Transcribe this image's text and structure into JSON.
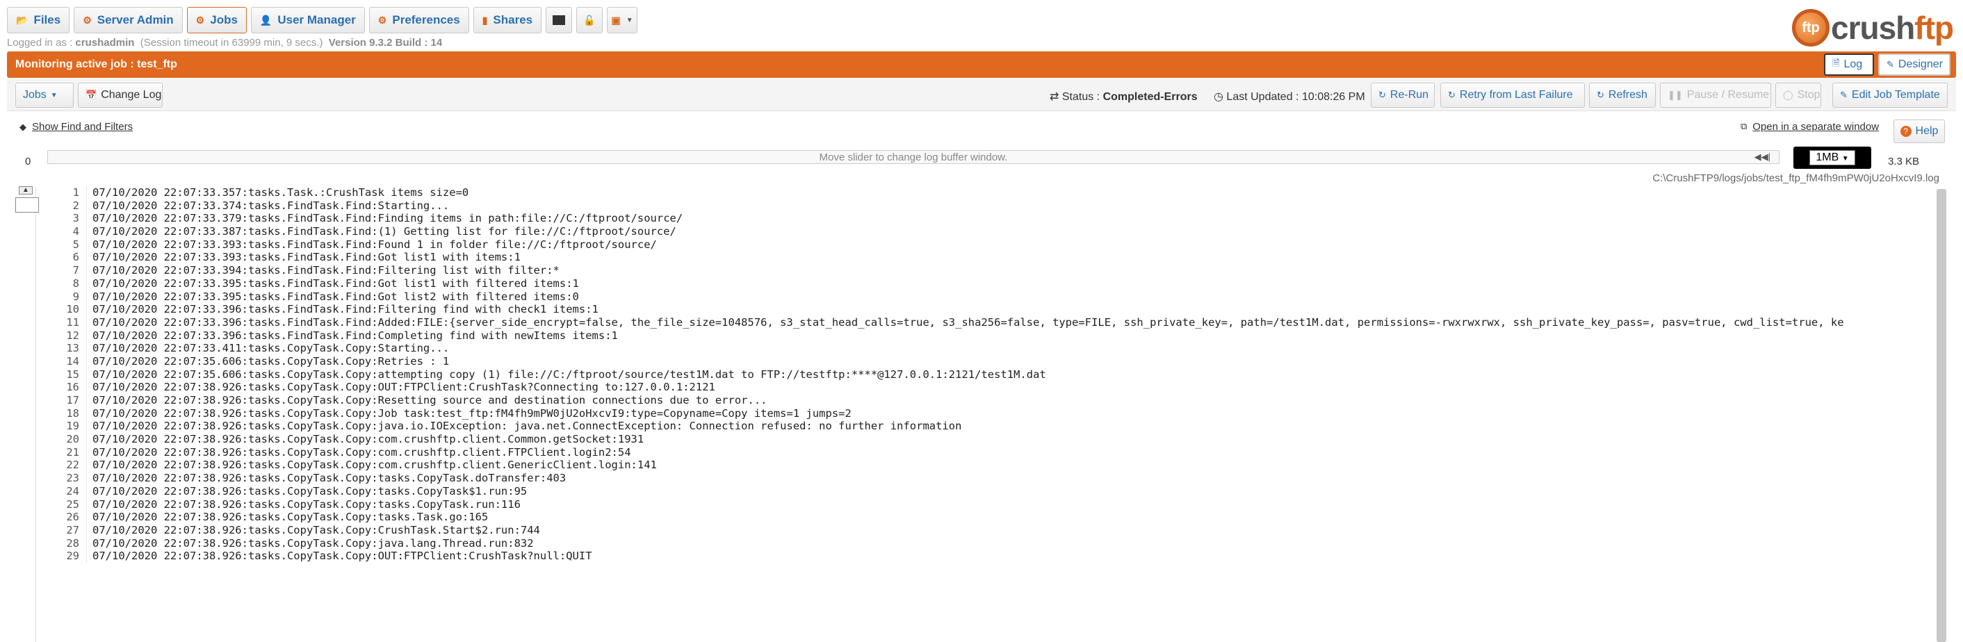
{
  "nav": {
    "files": "Files",
    "server_admin": "Server Admin",
    "jobs": "Jobs",
    "user_manager": "User Manager",
    "preferences": "Preferences",
    "shares": "Shares"
  },
  "session": {
    "logged_in_label": "Logged in as :",
    "user": "crushadmin",
    "timeout": "(Session timeout in 63999 min, 9 secs.)",
    "version": "Version 9.3.2 Build : 14"
  },
  "logo": {
    "mark": "ftp",
    "text_a": "crush",
    "text_b": "ftp"
  },
  "monitor": {
    "title": "Monitoring active job : test_ftp",
    "log_button": "Log",
    "designer_button": "Designer"
  },
  "toolbar": {
    "jobs": "Jobs",
    "change_log": "Change Log",
    "status_label": "Status :",
    "status_value": "Completed-Errors",
    "last_updated_label": "Last Updated :",
    "last_updated_value": "10:08:26 PM",
    "rerun": "Re-Run",
    "retry": "Retry from Last Failure",
    "refresh": "Refresh",
    "pause": "Pause / Resume",
    "stop": "Stop",
    "edit_template": "Edit Job Template"
  },
  "find": {
    "show_find": "Show Find and Filters",
    "open_window": "Open in a separate window",
    "help": "Help"
  },
  "buffer": {
    "min": "0",
    "slider_hint": "Move slider to change log buffer window.",
    "size_option": "1MB",
    "log_size": "3.3 KB",
    "path": "C:\\CrushFTP9/logs/jobs/test_ftp_fM4fh9mPW0jU2oHxcvI9.log"
  },
  "log_lines": [
    "07/10/2020 22:07:33.357:tasks.Task.:CrushTask items size=0",
    "07/10/2020 22:07:33.374:tasks.FindTask.Find:Starting...",
    "07/10/2020 22:07:33.379:tasks.FindTask.Find:Finding items in path:file://C:/ftproot/source/",
    "07/10/2020 22:07:33.387:tasks.FindTask.Find:(1) Getting list for file://C:/ftproot/source/",
    "07/10/2020 22:07:33.393:tasks.FindTask.Find:Found 1 in folder file://C:/ftproot/source/",
    "07/10/2020 22:07:33.393:tasks.FindTask.Find:Got list1 with items:1",
    "07/10/2020 22:07:33.394:tasks.FindTask.Find:Filtering list with filter:*",
    "07/10/2020 22:07:33.395:tasks.FindTask.Find:Got list1 with filtered items:1",
    "07/10/2020 22:07:33.395:tasks.FindTask.Find:Got list2 with filtered items:0",
    "07/10/2020 22:07:33.396:tasks.FindTask.Find:Filtering find with check1 items:1",
    "07/10/2020 22:07:33.396:tasks.FindTask.Find:Added:FILE:{server_side_encrypt=false, the_file_size=1048576, s3_stat_head_calls=true, s3_sha256=false, type=FILE, ssh_private_key=, path=/test1M.dat, permissions=-rwxrwxrwx, ssh_private_key_pass=, pasv=true, cwd_list=true, ke",
    "07/10/2020 22:07:33.396:tasks.FindTask.Find:Completing find with newItems items:1",
    "07/10/2020 22:07:33.411:tasks.CopyTask.Copy:Starting...",
    "07/10/2020 22:07:35.606:tasks.CopyTask.Copy:Retries : 1",
    "07/10/2020 22:07:35.606:tasks.CopyTask.Copy:attempting copy (1) file://C:/ftproot/source/test1M.dat to FTP://testftp:****@127.0.0.1:2121/test1M.dat",
    "07/10/2020 22:07:38.926:tasks.CopyTask.Copy:OUT:FTPClient:CrushTask?Connecting to:127.0.0.1:2121",
    "07/10/2020 22:07:38.926:tasks.CopyTask.Copy:Resetting source and destination connections due to error...",
    "07/10/2020 22:07:38.926:tasks.CopyTask.Copy:Job task:test_ftp:fM4fh9mPW0jU2oHxcvI9:type=Copyname=Copy items=1 jumps=2",
    "07/10/2020 22:07:38.926:tasks.CopyTask.Copy:java.io.IOException: java.net.ConnectException: Connection refused: no further information",
    "07/10/2020 22:07:38.926:tasks.CopyTask.Copy:com.crushftp.client.Common.getSocket:1931",
    "07/10/2020 22:07:38.926:tasks.CopyTask.Copy:com.crushftp.client.FTPClient.login2:54",
    "07/10/2020 22:07:38.926:tasks.CopyTask.Copy:com.crushftp.client.GenericClient.login:141",
    "07/10/2020 22:07:38.926:tasks.CopyTask.Copy:tasks.CopyTask.doTransfer:403",
    "07/10/2020 22:07:38.926:tasks.CopyTask.Copy:tasks.CopyTask$1.run:95",
    "07/10/2020 22:07:38.926:tasks.CopyTask.Copy:tasks.CopyTask.run:116",
    "07/10/2020 22:07:38.926:tasks.CopyTask.Copy:tasks.Task.go:165",
    "07/10/2020 22:07:38.926:tasks.CopyTask.Copy:CrushTask.Start$2.run:744",
    "07/10/2020 22:07:38.926:tasks.CopyTask.Copy:java.lang.Thread.run:832",
    "07/10/2020 22:07:38.926:tasks.CopyTask.Copy:OUT:FTPClient:CrushTask?null:QUIT"
  ],
  "colors": {
    "accent": "#e0691f",
    "link": "#2a6fb0"
  }
}
